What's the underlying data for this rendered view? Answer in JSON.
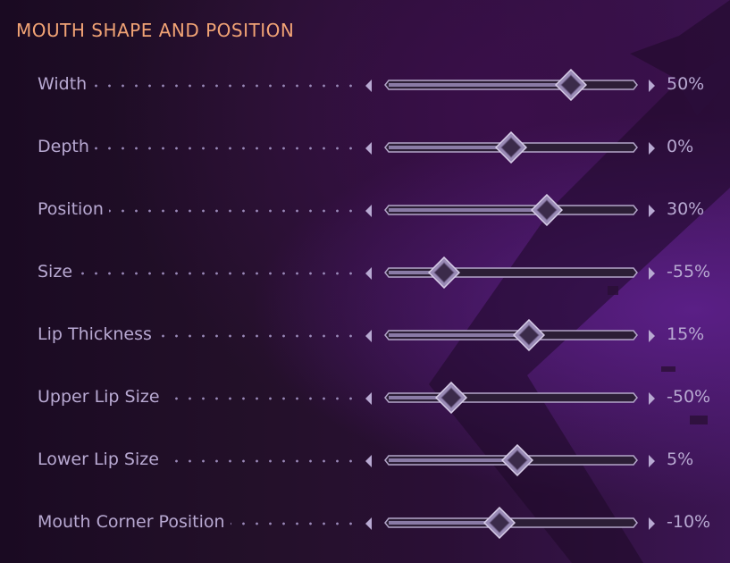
{
  "panel": {
    "title": "MOUTH SHAPE AND POSITION"
  },
  "sliders": [
    {
      "label": "Width",
      "value": "50%",
      "level": 0.75
    },
    {
      "label": "Depth",
      "value": "0%",
      "level": 0.5
    },
    {
      "label": "Position",
      "value": "30%",
      "level": 0.65
    },
    {
      "label": "Size",
      "value": "-55%",
      "level": 0.22
    },
    {
      "label": "Lip Thickness",
      "value": "15%",
      "level": 0.575
    },
    {
      "label": "Upper Lip Size",
      "value": "-50%",
      "level": 0.25
    },
    {
      "label": "Lower Lip Size",
      "value": "5%",
      "level": 0.525
    },
    {
      "label": "Mouth Corner Position",
      "value": "-10%",
      "level": 0.45
    }
  ],
  "colors": {
    "title": "#f1a375",
    "text": "#b8a9d2",
    "track_fill": "#8a7ba6",
    "track_border": "#b3a6c9"
  },
  "icons": {
    "decrement": "left-arrow-icon",
    "increment": "right-arrow-icon",
    "thumb": "diamond-thumb-icon"
  }
}
